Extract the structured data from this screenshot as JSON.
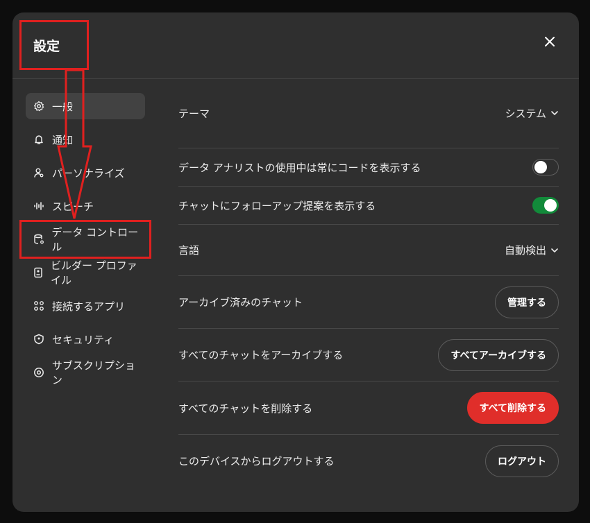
{
  "title": "設定",
  "sidebar": {
    "items": [
      {
        "label": "一般",
        "icon": "gear-icon"
      },
      {
        "label": "通知",
        "icon": "bell-icon"
      },
      {
        "label": "パーソナライズ",
        "icon": "person-icon"
      },
      {
        "label": "スピーチ",
        "icon": "waveform-icon"
      },
      {
        "label": "データ コントロール",
        "icon": "database-gear-icon"
      },
      {
        "label": "ビルダー プロファイル",
        "icon": "id-card-icon"
      },
      {
        "label": "接続するアプリ",
        "icon": "apps-grid-icon"
      },
      {
        "label": "セキュリティ",
        "icon": "shield-icon"
      },
      {
        "label": "サブスクリプション",
        "icon": "subscription-gear-icon"
      }
    ]
  },
  "settings": {
    "theme": {
      "label": "テーマ",
      "value": "システム"
    },
    "code_toggle": {
      "label": "データ アナリストの使用中は常にコードを表示する",
      "state": "off"
    },
    "followup_toggle": {
      "label": "チャットにフォローアップ提案を表示する",
      "state": "on"
    },
    "language": {
      "label": "言語",
      "value": "自動検出"
    },
    "archived": {
      "label": "アーカイブ済みのチャット",
      "button": "管理する"
    },
    "archive_all": {
      "label": "すべてのチャットをアーカイブする",
      "button": "すべてアーカイブする"
    },
    "delete_all": {
      "label": "すべてのチャットを削除する",
      "button": "すべて削除する"
    },
    "logout": {
      "label": "このデバイスからログアウトする",
      "button": "ログアウト"
    }
  },
  "colors": {
    "accent_red": "#e02e2a",
    "toggle_on": "#128a3a",
    "annotation": "#e0201f"
  }
}
